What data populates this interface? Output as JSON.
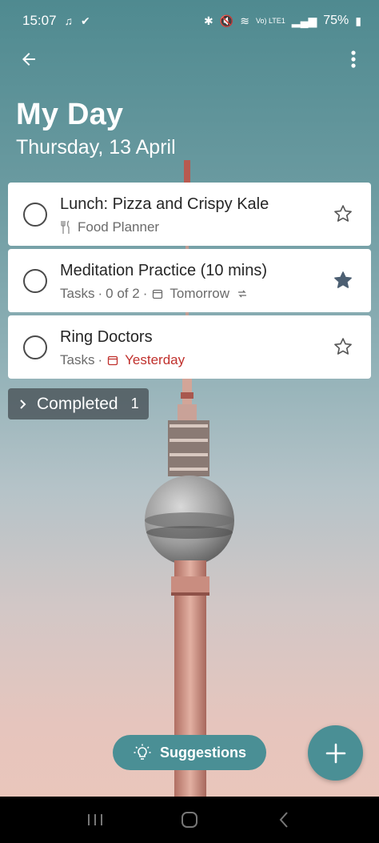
{
  "status_bar": {
    "time": "15:07",
    "battery": "75%",
    "network_label": "Vo) LTE1"
  },
  "app_bar": {
    "back_icon": "arrow-left-icon",
    "more_icon": "more-vertical-icon"
  },
  "header": {
    "title": "My Day",
    "date": "Thursday, 13 April"
  },
  "tasks": [
    {
      "title": "Lunch: Pizza and Crispy Kale",
      "list_icon": "fork-knife-icon",
      "list": "Food Planner",
      "starred": false
    },
    {
      "title": "Meditation Practice (10 mins)",
      "list": "Tasks",
      "steps": "0 of 2",
      "due": "Tomorrow",
      "repeat": true,
      "starred": true
    },
    {
      "title": "Ring Doctors",
      "list": "Tasks",
      "due": "Yesterday",
      "overdue": true,
      "starred": false
    }
  ],
  "completed": {
    "label": "Completed",
    "count": "1"
  },
  "suggestions": {
    "label": "Suggestions"
  },
  "colors": {
    "accent": "#4a8f95",
    "overdue": "#c0302c"
  }
}
